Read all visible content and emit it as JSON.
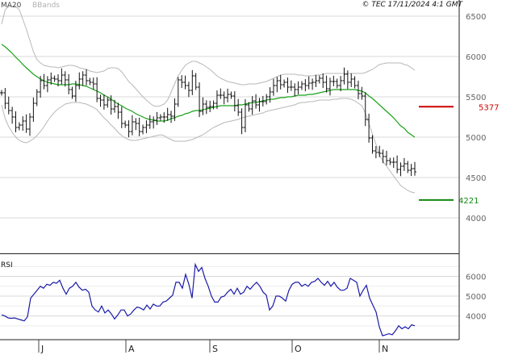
{
  "header": {
    "legend": [
      "MA20",
      "BBands"
    ],
    "copyright": "© TEC 17/11/2024 4:1 GMT"
  },
  "colors": {
    "price_bar": "#111111",
    "ma20": "#19a319",
    "bbands": "#b8b8b8",
    "rsi_line": "#1a1aa8",
    "resistance": "#cc0000",
    "support": "#118811",
    "grid": "#d8d8d8",
    "axis_text": "#666666"
  },
  "chart_data": [
    {
      "type": "ohlc",
      "panel": "price",
      "x_ticks": [
        "J",
        "A",
        "S",
        "O",
        "N"
      ],
      "y_ticks": [
        4000,
        4500,
        5000,
        5500,
        6000,
        6500
      ],
      "y_tick_labels": [
        "4000",
        "4500",
        "5000",
        "5500",
        "6000",
        "6500"
      ],
      "ylim": [
        3570,
        6700
      ],
      "grid": true,
      "levels": [
        {
          "name": "resistance",
          "value": 5377,
          "label": "5377"
        },
        {
          "name": "support",
          "value": 4221,
          "label": "4221"
        }
      ],
      "closes": [
        5550,
        5420,
        5330,
        5250,
        5120,
        5150,
        5200,
        5100,
        5250,
        5420,
        5560,
        5700,
        5640,
        5710,
        5730,
        5720,
        5700,
        5770,
        5710,
        5590,
        5510,
        5640,
        5720,
        5770,
        5700,
        5680,
        5660,
        5480,
        5460,
        5400,
        5460,
        5350,
        5380,
        5310,
        5170,
        5150,
        5070,
        5190,
        5170,
        5070,
        5120,
        5150,
        5190,
        5210,
        5240,
        5250,
        5250,
        5280,
        5260,
        5410,
        5710,
        5680,
        5640,
        5580,
        5760,
        5620,
        5320,
        5410,
        5370,
        5380,
        5420,
        5520,
        5520,
        5490,
        5530,
        5510,
        5390,
        5310,
        5120,
        5400,
        5350,
        5450,
        5400,
        5440,
        5440,
        5500,
        5560,
        5640,
        5700,
        5650,
        5680,
        5620,
        5620,
        5590,
        5620,
        5660,
        5640,
        5670,
        5680,
        5700,
        5730,
        5680,
        5600,
        5690,
        5690,
        5640,
        5700,
        5780,
        5680,
        5720,
        5640,
        5540,
        5510,
        5220,
        4990,
        4830,
        4810,
        4800,
        4760,
        4710,
        4690,
        4690,
        4600,
        4640,
        4670,
        4590,
        4610,
        4570
      ],
      "ma20": [
        6150,
        6120,
        6080,
        6040,
        5990,
        5950,
        5900,
        5860,
        5820,
        5780,
        5750,
        5720,
        5700,
        5680,
        5670,
        5660,
        5650,
        5650,
        5650,
        5650,
        5660,
        5660,
        5650,
        5640,
        5630,
        5610,
        5590,
        5570,
        5550,
        5520,
        5500,
        5470,
        5440,
        5410,
        5390,
        5360,
        5340,
        5320,
        5290,
        5270,
        5250,
        5230,
        5220,
        5210,
        5200,
        5200,
        5200,
        5210,
        5230,
        5240,
        5260,
        5270,
        5290,
        5300,
        5320,
        5330,
        5330,
        5340,
        5350,
        5360,
        5370,
        5380,
        5390,
        5390,
        5390,
        5390,
        5390,
        5400,
        5400,
        5410,
        5420,
        5430,
        5430,
        5440,
        5450,
        5460,
        5470,
        5470,
        5480,
        5490,
        5490,
        5500,
        5500,
        5510,
        5520,
        5520,
        5520,
        5530,
        5530,
        5540,
        5550,
        5560,
        5570,
        5580,
        5590,
        5590,
        5590,
        5590,
        5590,
        5590,
        5590,
        5580,
        5570,
        5550,
        5510,
        5480,
        5440,
        5400,
        5360,
        5320,
        5280,
        5240,
        5190,
        5140,
        5110,
        5060,
        5030,
        5000
      ],
      "bb_upper": [
        6400,
        6580,
        6620,
        6620,
        6620,
        6580,
        6460,
        6340,
        6200,
        6060,
        5960,
        5920,
        5890,
        5880,
        5870,
        5870,
        5860,
        5870,
        5880,
        5890,
        5890,
        5880,
        5860,
        5850,
        5840,
        5820,
        5810,
        5800,
        5810,
        5820,
        5850,
        5860,
        5860,
        5850,
        5810,
        5750,
        5690,
        5650,
        5600,
        5550,
        5500,
        5460,
        5420,
        5390,
        5380,
        5390,
        5410,
        5460,
        5560,
        5660,
        5760,
        5830,
        5890,
        5920,
        5940,
        5940,
        5920,
        5900,
        5870,
        5840,
        5800,
        5760,
        5730,
        5710,
        5690,
        5680,
        5670,
        5660,
        5650,
        5650,
        5660,
        5660,
        5660,
        5670,
        5680,
        5690,
        5710,
        5730,
        5750,
        5770,
        5780,
        5780,
        5780,
        5780,
        5770,
        5770,
        5760,
        5760,
        5760,
        5770,
        5770,
        5780,
        5790,
        5790,
        5790,
        5790,
        5790,
        5790,
        5790,
        5790,
        5790,
        5790,
        5790,
        5800,
        5820,
        5840,
        5870,
        5900,
        5910,
        5920,
        5920,
        5920,
        5920,
        5920,
        5900,
        5890,
        5860,
        5830
      ],
      "bb_lower": [
        5400,
        5230,
        5130,
        5060,
        5000,
        4960,
        4940,
        4930,
        4950,
        4980,
        5020,
        5070,
        5130,
        5200,
        5260,
        5310,
        5350,
        5380,
        5410,
        5420,
        5430,
        5430,
        5430,
        5420,
        5410,
        5390,
        5370,
        5340,
        5290,
        5240,
        5200,
        5150,
        5110,
        5060,
        5020,
        4990,
        4970,
        4960,
        4960,
        4970,
        4980,
        4990,
        5000,
        5010,
        5020,
        5030,
        5020,
        4990,
        4970,
        4950,
        4950,
        4950,
        4950,
        4960,
        4970,
        4990,
        5010,
        5030,
        5060,
        5090,
        5120,
        5140,
        5160,
        5180,
        5190,
        5200,
        5210,
        5220,
        5240,
        5250,
        5260,
        5270,
        5280,
        5290,
        5300,
        5320,
        5330,
        5340,
        5350,
        5360,
        5370,
        5380,
        5390,
        5400,
        5420,
        5430,
        5430,
        5440,
        5440,
        5450,
        5460,
        5460,
        5460,
        5460,
        5470,
        5470,
        5480,
        5480,
        5480,
        5470,
        5450,
        5420,
        5390,
        5300,
        5170,
        5040,
        4910,
        4780,
        4700,
        4640,
        4580,
        4520,
        4460,
        4400,
        4370,
        4340,
        4320,
        4310
      ]
    },
    {
      "type": "line",
      "panel": "rsi",
      "title": "RSI",
      "y_ticks": [
        4000,
        5000,
        6000
      ],
      "y_tick_labels": [
        "4000",
        "5000",
        "6000"
      ],
      "ylim": [
        2800,
        7000
      ],
      "grid": true,
      "values": [
        4050,
        4000,
        3900,
        3880,
        3900,
        3850,
        3800,
        3750,
        3950,
        4900,
        5100,
        5300,
        5500,
        5400,
        5600,
        5550,
        5700,
        5650,
        5800,
        5400,
        5100,
        5400,
        5500,
        5700,
        5450,
        5300,
        5350,
        5200,
        4500,
        4300,
        4200,
        4500,
        4150,
        4300,
        4100,
        3850,
        4050,
        4300,
        4300,
        4000,
        4100,
        4300,
        4450,
        4400,
        4300,
        4550,
        4350,
        4600,
        4500,
        4500,
        4700,
        4750,
        4900,
        5050,
        5700,
        5700,
        5400,
        6100,
        5600,
        4900,
        6600,
        6250,
        6450,
        5900,
        5500,
        5000,
        4700,
        4700,
        4950,
        5000,
        5200,
        5350,
        5100,
        5400,
        5100,
        5200,
        5500,
        5350,
        5550,
        5700,
        5500,
        5200,
        5050,
        4300,
        4500,
        5000,
        5000,
        4900,
        4750,
        5300,
        5600,
        5700,
        5700,
        5500,
        5600,
        5500,
        5700,
        5750,
        5900,
        5700,
        5550,
        5750,
        5500,
        5700,
        5450,
        5300,
        5300,
        5400,
        5900,
        5800,
        5700,
        5000,
        5300,
        5550,
        4900,
        4550,
        4200,
        3450,
        3000,
        3050,
        3100,
        3050,
        3250,
        3500,
        3350,
        3450,
        3350,
        3550,
        3500
      ]
    }
  ]
}
